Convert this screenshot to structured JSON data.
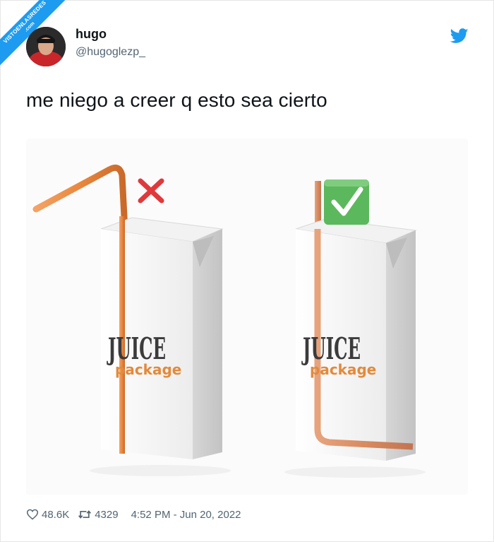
{
  "watermark": {
    "line1": "VISTOENLASREDES",
    "line2": ".com"
  },
  "tweet": {
    "display_name": "hugo",
    "handle": "@hugoglezp_",
    "text": "me niego a creer q esto sea cierto",
    "likes": "48.6K",
    "retweets": "4329",
    "timestamp": "4:52 PM - Jun 20, 2022"
  },
  "image": {
    "left_box": {
      "brand": "JUICE",
      "sub": "package",
      "mark": "cross"
    },
    "right_box": {
      "brand": "JUICE",
      "sub": "package",
      "mark": "check"
    }
  },
  "colors": {
    "twitter_blue": "#1d9bf0",
    "straw_orange": "#e9873e",
    "cross_red": "#e0393b",
    "check_green": "#5cb85c",
    "brand_dark": "#3b3b3b",
    "brand_orange": "#e28a3c"
  },
  "icons": {
    "bird": "twitter-bird-icon",
    "like": "heart-icon",
    "retweet": "retweet-icon"
  }
}
